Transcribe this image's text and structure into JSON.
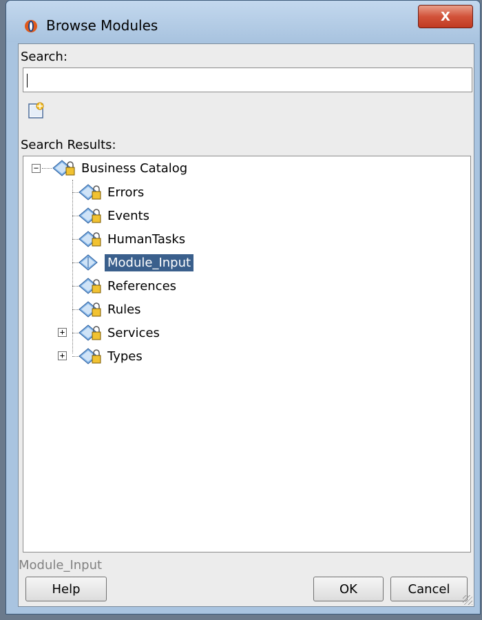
{
  "window": {
    "title": "Browse Modules",
    "close_label": "X"
  },
  "search": {
    "label": "Search:",
    "value": "",
    "placeholder": ""
  },
  "results": {
    "label": "Search Results:",
    "tree": [
      {
        "label": "Business Catalog",
        "expanded": true,
        "level": 0
      },
      {
        "label": "Errors",
        "level": 1
      },
      {
        "label": "Events",
        "level": 1
      },
      {
        "label": "HumanTasks",
        "level": 1
      },
      {
        "label": "Module_Input",
        "level": 1,
        "selected": true
      },
      {
        "label": "References",
        "level": 1
      },
      {
        "label": "Rules",
        "level": 1
      },
      {
        "label": "Services",
        "level": 1,
        "expandable": true
      },
      {
        "label": "Types",
        "level": 1,
        "expandable": true
      }
    ]
  },
  "status_text": "Module_Input",
  "buttons": {
    "help": "Help",
    "ok": "OK",
    "cancel": "Cancel"
  },
  "icons": {
    "app": "oracle-jdeveloper-icon",
    "new": "new-item-icon",
    "node": "locked-module-icon",
    "node_unlocked": "module-icon"
  },
  "colors": {
    "selection": "#3a5f8c",
    "close": "#c03a22"
  }
}
